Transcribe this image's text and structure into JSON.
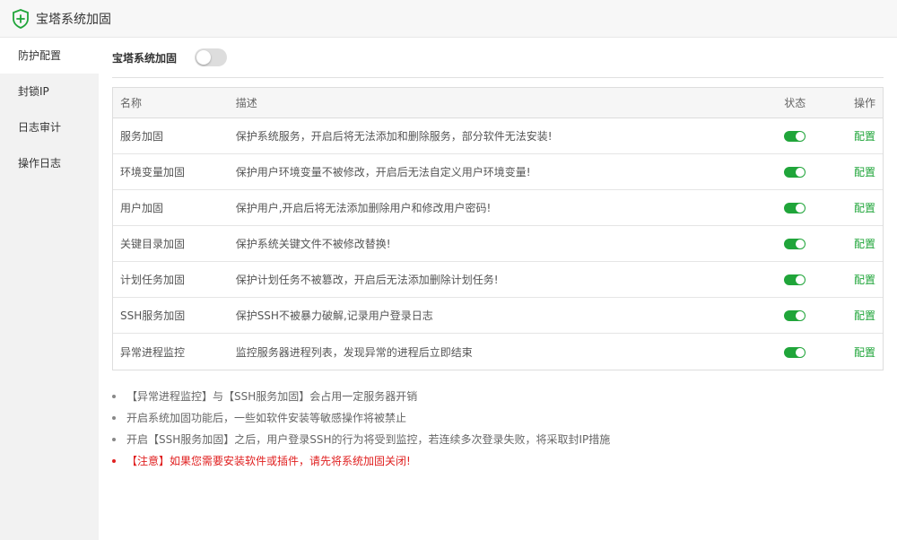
{
  "window": {
    "title": "宝塔系统加固",
    "icon": "shield-plus-icon",
    "accent": "#20a53a"
  },
  "sidebar": {
    "items": [
      {
        "label": "防护配置",
        "active": true
      },
      {
        "label": "封锁IP",
        "active": false
      },
      {
        "label": "日志审计",
        "active": false
      },
      {
        "label": "操作日志",
        "active": false
      }
    ]
  },
  "main_switch": {
    "label": "宝塔系统加固",
    "on": false
  },
  "table": {
    "headers": {
      "name": "名称",
      "desc": "描述",
      "state": "状态",
      "op": "操作"
    },
    "rows": [
      {
        "name": "服务加固",
        "desc": "保护系统服务，开启后将无法添加和删除服务，部分软件无法安装!",
        "on": true,
        "op": "配置"
      },
      {
        "name": "环境变量加固",
        "desc": "保护用户环境变量不被修改，开启后无法自定义用户环境变量!",
        "on": true,
        "op": "配置"
      },
      {
        "name": "用户加固",
        "desc": "保护用户,开启后将无法添加删除用户和修改用户密码!",
        "on": true,
        "op": "配置"
      },
      {
        "name": "关键目录加固",
        "desc": "保护系统关键文件不被修改替换!",
        "on": true,
        "op": "配置"
      },
      {
        "name": "计划任务加固",
        "desc": "保护计划任务不被篡改，开启后无法添加删除计划任务!",
        "on": true,
        "op": "配置"
      },
      {
        "name": "SSH服务加固",
        "desc": "保护SSH不被暴力破解,记录用户登录日志",
        "on": true,
        "op": "配置"
      },
      {
        "name": "异常进程监控",
        "desc": "监控服务器进程列表，发现异常的进程后立即结束",
        "on": true,
        "op": "配置"
      }
    ]
  },
  "notes": [
    {
      "text": "【异常进程监控】与【SSH服务加固】会占用一定服务器开销",
      "warn": false
    },
    {
      "text": "开启系统加固功能后，一些如软件安装等敏感操作将被禁止",
      "warn": false
    },
    {
      "text": "开启【SSH服务加固】之后，用户登录SSH的行为将受到监控，若连续多次登录失败，将采取封IP措施",
      "warn": false
    },
    {
      "text": "【注意】如果您需要安装软件或插件，请先将系统加固关闭!",
      "warn": true
    }
  ]
}
